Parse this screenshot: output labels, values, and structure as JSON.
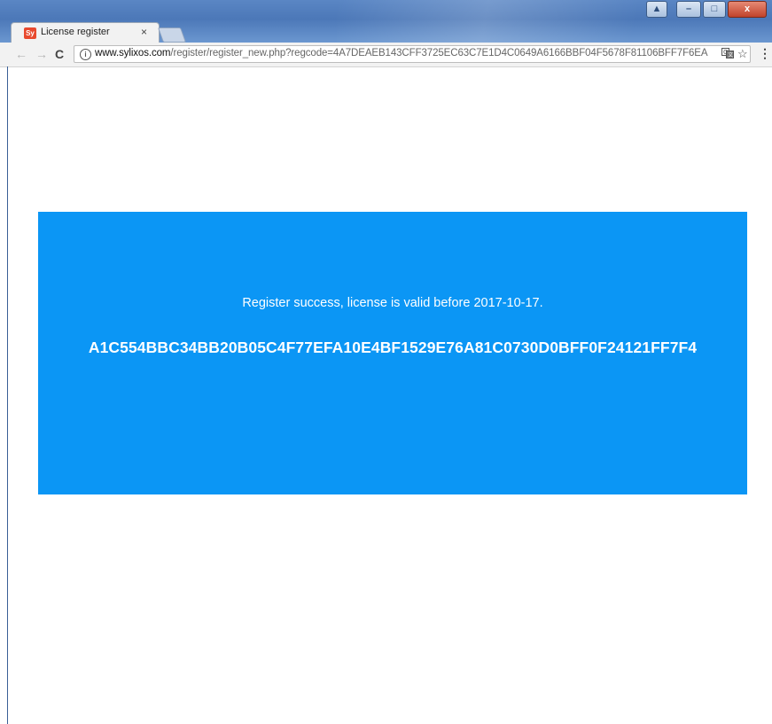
{
  "browser": {
    "tab": {
      "favicon_text": "Sy",
      "title": "License register",
      "close_glyph": "×"
    },
    "window_controls": {
      "pin": "▲",
      "minimize": "–",
      "maximize": "□",
      "close": "x"
    },
    "nav": {
      "back": "←",
      "forward": "→",
      "reload": "C"
    },
    "address_bar": {
      "info_glyph": "i",
      "host": "www.sylixos.com",
      "path": "/register/register_new.php?regcode=4A7DEAEB143CFF3725EC63C7E1D4C0649A6166BBF04F5678F81106BFF7F6EA"
    },
    "icons": {
      "translate": "translate-icon",
      "bookmark": "star-icon",
      "menu": "menu-icon"
    }
  },
  "page": {
    "message": "Register success, license is valid before 2017-10-17.",
    "license_code": "A1C554BBC34BB20B05C4F77EFA10E4BF1529E76A81C0730D0BFF0F24121FF7F4",
    "panel_color": "#0b96f5"
  }
}
